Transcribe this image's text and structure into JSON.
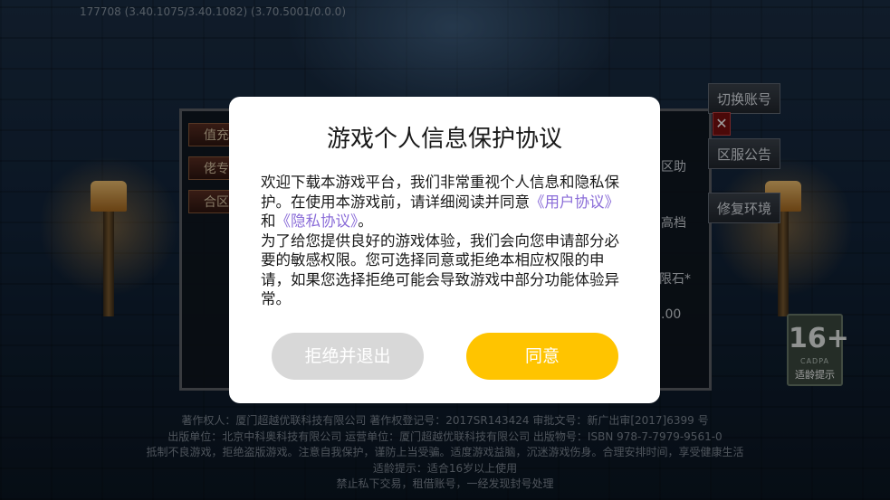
{
  "version_text": "177708 (3.40.1075/3.40.1082) (3.70.5001/0.0.0)",
  "background_panel": {
    "left_tabs": [
      "值充",
      "佬专",
      "合区"
    ],
    "side_buttons": [
      "切换账号",
      "区服公告",
      "修复环境"
    ],
    "close_label": "✕",
    "right_fragments": [
      "区助",
      "高档",
      "限石*",
      ".00"
    ]
  },
  "age_badge": {
    "number": "16+",
    "org": "CADPA",
    "tip": "适龄提示"
  },
  "footer": {
    "lines": [
      "著作权人：厦门超越优联科技有限公司 著作权登记号：2017SR143424 审批文号：新广出审[2017]6399 号",
      "出版单位：北京中科奥科技有限公司 运营单位：厦门超越优联科技有限公司 出版物号：ISBN 978-7-7979-9561-0",
      "抵制不良游戏，拒绝盗版游戏。注意自我保护，谨防上当受骗。适度游戏益脑，沉迷游戏伤身。合理安排时间，享受健康生活",
      "适龄提示：适合16岁以上使用",
      "禁止私下交易，租借账号，一经发现封号处理"
    ]
  },
  "modal": {
    "title": "游戏个人信息保护协议",
    "para1_before": "欢迎下载本游戏平台，我们非常重视个人信息和隐私保护。在使用本游戏前，请详细阅读并同意",
    "user_agreement_link": "《用户协议》",
    "para1_and": "和",
    "privacy_link": "《隐私协议》",
    "para1_end": "。",
    "para2": "为了给您提供良好的游戏体验，我们会向您申请部分必要的敏感权限。您可选择同意或拒绝本相应权限的申请，如果您选择拒绝可能会导致游戏中部分功能体验异常。",
    "reject_label": "拒绝并退出",
    "agree_label": "同意"
  },
  "colors": {
    "agree_button": "#ffc400",
    "reject_button": "#d8d8d8",
    "link": "#8a6cd8"
  }
}
